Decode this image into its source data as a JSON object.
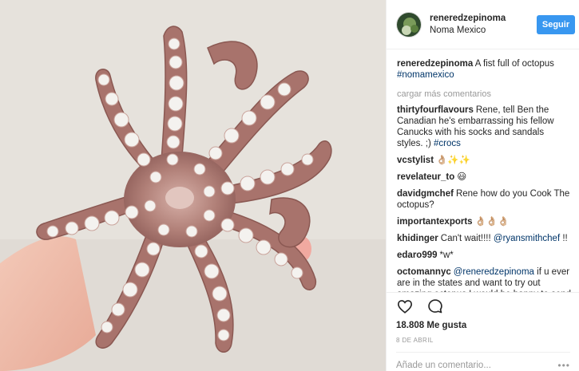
{
  "header": {
    "username": "reneredzepinoma",
    "location": "Noma Mexico",
    "follow_label": "Seguir"
  },
  "caption": {
    "author": "reneredzepinoma",
    "text": "A fist full of octopus",
    "hashtag": "#nomamexico"
  },
  "load_more_label": "cargar más comentarios",
  "comments": [
    {
      "user": "thirtyfourflavours",
      "text": "Rene, tell Ben the Canadian he's embarrassing his fellow Canucks with his socks and sandals styles. ;)",
      "link": "#crocs"
    },
    {
      "user": "vcstylist",
      "text": "👌🏼✨✨",
      "link": ""
    },
    {
      "user": "revelateur_to",
      "text": "😃",
      "link": ""
    },
    {
      "user": "davidgmchef",
      "text": "Rene how do you Cook The octopus?",
      "link": ""
    },
    {
      "user": "importantexports",
      "text": "👌🏼👌🏼👌🏼",
      "link": ""
    },
    {
      "user": "khidinger",
      "text": "Can't wait!!!!",
      "link": "@ryansmithchef",
      "suffix": "!!"
    },
    {
      "user": "edaro999",
      "text": "*w*",
      "link": ""
    },
    {
      "user": "octomannyc",
      "link": "@reneredzepinoma",
      "text": "if u ever are in the states and want to try out amazing octopus I would be happy to send u some. Very special. 🐙 I'm friends"
    }
  ],
  "actions": {
    "like_icon": "heart-icon",
    "comment_icon": "comment-icon",
    "likes_text": "18.808 Me gusta",
    "date": "8 de abril"
  },
  "add_comment": {
    "placeholder": "Añade un comentario...",
    "more_icon": "ellipsis-icon"
  },
  "colors": {
    "accent": "#3897f0",
    "link": "#003569",
    "muted": "#999999",
    "octopus_skin": "#a5746c",
    "sucker": "#f2f0ee"
  }
}
